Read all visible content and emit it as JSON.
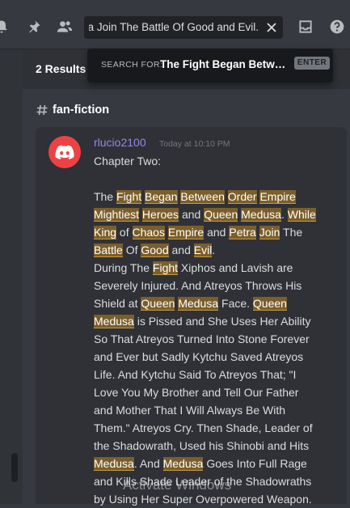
{
  "toolbar": {
    "icons": [
      "bell-icon",
      "pin-icon",
      "members-icon",
      "inbox-icon",
      "help-icon"
    ],
    "search_value": "etra Join The Battle Of Good and Evil."
  },
  "results": {
    "count_label": "2 Results"
  },
  "search_popout": {
    "prefix": "SEARCH FOR:",
    "query": "The Fight Began Betwee…",
    "enter_label": "ENTER"
  },
  "channel": {
    "name": "fan-fiction"
  },
  "message": {
    "author": "rlucio2100",
    "timestamp": "Today at 10:10 PM",
    "author_color": "#9b84ec",
    "highlight_color": "#7b5e2a",
    "lines": [
      [
        {
          "t": "Chapter Two:"
        }
      ],
      [],
      [
        {
          "t": "The "
        },
        {
          "t": "Fight",
          "h": true
        },
        {
          "t": " "
        },
        {
          "t": "Began",
          "h": true
        },
        {
          "t": " "
        },
        {
          "t": "Between",
          "h": true
        },
        {
          "t": " "
        },
        {
          "t": "Order",
          "h": true
        },
        {
          "t": " "
        },
        {
          "t": "Empire",
          "h": true
        }
      ],
      [
        {
          "t": "Mightiest",
          "h": true
        },
        {
          "t": " "
        },
        {
          "t": "Heroes",
          "h": true
        },
        {
          "t": " and "
        },
        {
          "t": "Queen",
          "h": true
        },
        {
          "t": " "
        },
        {
          "t": "Medusa",
          "h": true
        },
        {
          "t": ". "
        },
        {
          "t": "While",
          "h": true
        }
      ],
      [
        {
          "t": " "
        },
        {
          "t": "King",
          "h": true
        },
        {
          "t": " of "
        },
        {
          "t": "Chaos",
          "h": true
        },
        {
          "t": " "
        },
        {
          "t": "Empire",
          "h": true
        },
        {
          "t": " and "
        },
        {
          "t": "Petra",
          "h": true
        },
        {
          "t": " "
        },
        {
          "t": "Join",
          "h": true
        },
        {
          "t": " The"
        }
      ],
      [
        {
          "t": "Battle",
          "h": true
        },
        {
          "t": " Of "
        },
        {
          "t": "Good",
          "h": true
        },
        {
          "t": " and "
        },
        {
          "t": "Evil",
          "h": true
        },
        {
          "t": "."
        }
      ],
      [
        {
          "t": "During The "
        },
        {
          "t": "Fight",
          "h": true
        },
        {
          "t": " Xiphos and Lavish are"
        }
      ],
      [
        {
          "t": "Severely Injured. And Atreyos Throws His"
        }
      ],
      [
        {
          "t": "Shield at "
        },
        {
          "t": "Queen",
          "h": true
        },
        {
          "t": " "
        },
        {
          "t": "Medusa",
          "h": true
        },
        {
          "t": " Face. "
        },
        {
          "t": "Queen",
          "h": true
        }
      ],
      [
        {
          "t": "Medusa",
          "h": true
        },
        {
          "t": " is Pissed and She Uses Her Ability"
        }
      ],
      [
        {
          "t": "So That Atreyos Turned Into Stone Forever"
        }
      ],
      [
        {
          "t": "and Ever but Sadly Kytchu Saved Atreyos"
        }
      ],
      [
        {
          "t": "Life. And Kytchu Said To Atreyos That; \"I"
        }
      ],
      [
        {
          "t": "Love You My Brother and Tell Our Father"
        }
      ],
      [
        {
          "t": "and Mother That I Will Always Be With"
        }
      ],
      [
        {
          "t": "Them.\" Atreyos Cry. Then Shade, Leader of"
        }
      ],
      [
        {
          "t": "the Shadowrath, Used his Shinobi and Hits"
        }
      ],
      [
        {
          "t": "Medusa",
          "h": true
        },
        {
          "t": ". And "
        },
        {
          "t": "Medusa",
          "h": true
        },
        {
          "t": " Goes Into Full Rage"
        }
      ],
      [
        {
          "t": "and Kills Shade Leader of the Shadowraths"
        }
      ],
      [
        {
          "t": "by Using Her Super Overpowered Weapon."
        }
      ]
    ]
  },
  "watermark": "Activate Windows"
}
